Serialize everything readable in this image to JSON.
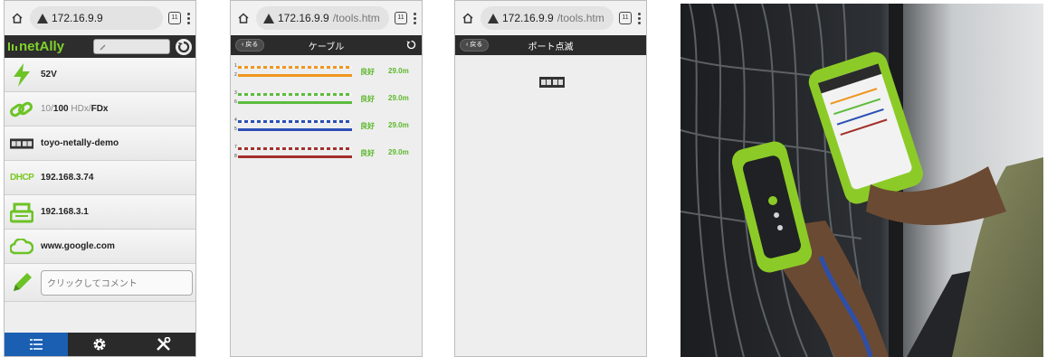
{
  "screen1": {
    "url": "172.16.9.9",
    "tab_count": "11",
    "brand": "netAlly",
    "rows": {
      "poe": "52V",
      "speed_lo": "10/",
      "speed_hi": "100",
      "speed_hdx": " HDx/",
      "speed_fdx": "FDx",
      "switch_name": "toyo-netally-demo",
      "dhcp_label": "DHCP",
      "dhcp_ip": "192.168.3.74",
      "gateway_ip": "192.168.3.1",
      "web_host": "www.google.com",
      "comment_placeholder": "クリックしてコメント"
    }
  },
  "screen2": {
    "url_host": "172.16.9.9",
    "url_path": "/tools.htm",
    "tab_count": "11",
    "back_label": "戻る",
    "title": "ケーブル",
    "pairs": [
      {
        "pin_a": "1",
        "pin_b": "2",
        "status": "良好",
        "length": "29.0m",
        "color": "#f0961e"
      },
      {
        "pin_a": "3",
        "pin_b": "6",
        "status": "良好",
        "length": "29.0m",
        "color": "#5cbc3c"
      },
      {
        "pin_a": "4",
        "pin_b": "5",
        "status": "良好",
        "length": "29.0m",
        "color": "#2b4fb5"
      },
      {
        "pin_a": "7",
        "pin_b": "8",
        "status": "良好",
        "length": "29.0m",
        "color": "#a3302b"
      }
    ]
  },
  "screen3": {
    "url_host": "172.16.9.9",
    "url_path": "/tools.htm",
    "tab_count": "11",
    "back_label": "戻る",
    "title": "ポート点滅"
  },
  "colors": {
    "accent_green": "#7fd12a",
    "header_dark": "#2b2b2b",
    "nav_active": "#1b5fb2"
  }
}
